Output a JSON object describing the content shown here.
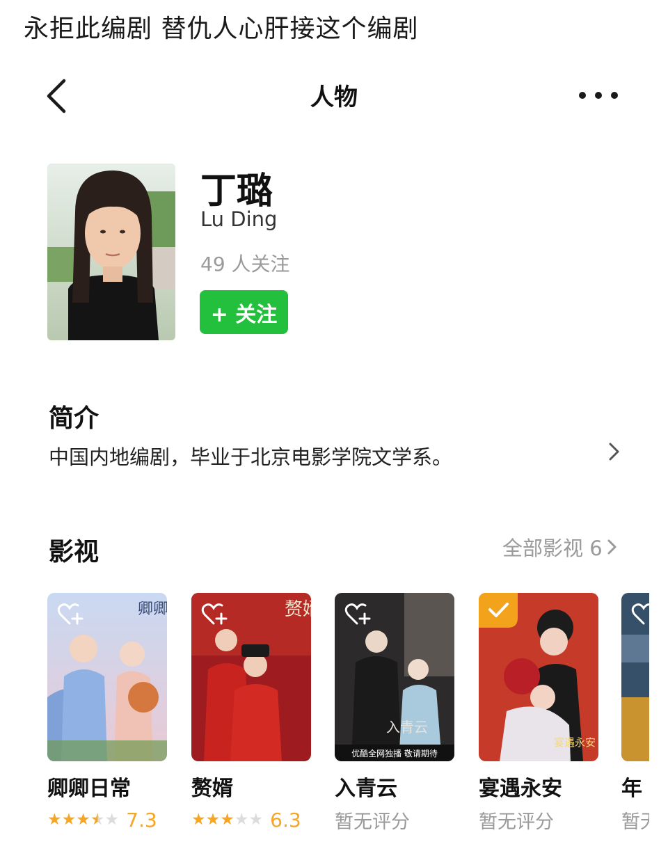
{
  "caption": "永拒此编剧 替仇人心肝接这个编剧",
  "nav": {
    "title": "人物"
  },
  "person": {
    "name": "丁璐",
    "en_name": "Lu Ding",
    "followers": "49 人关注",
    "follow_label": "+ 关注"
  },
  "intro": {
    "title": "简介",
    "text": "中国内地编剧，毕业于北京电影学院文学系。"
  },
  "films_section": {
    "title": "影视",
    "all_label": "全部影视 6"
  },
  "films": [
    {
      "title": "卿卿日常",
      "rating": "7.3",
      "stars": 3.5,
      "poster_text": "卿卿日常"
    },
    {
      "title": "赘婿",
      "rating": "6.3",
      "stars": 3,
      "poster_text": "赘婿"
    },
    {
      "title": "入青云",
      "rating_text": "暂无评分",
      "poster_text": "入青云",
      "poster_banner": "优酷全网独播 敬请期待"
    },
    {
      "title": "宴遇永安",
      "rating_text": "暂无评分",
      "poster_text": "宴遇永安"
    },
    {
      "title": "年",
      "rating_text": "暂无"
    }
  ],
  "colors": {
    "accent_green": "#22c03c",
    "star": "#f6a623",
    "muted": "#9a9a9a"
  }
}
